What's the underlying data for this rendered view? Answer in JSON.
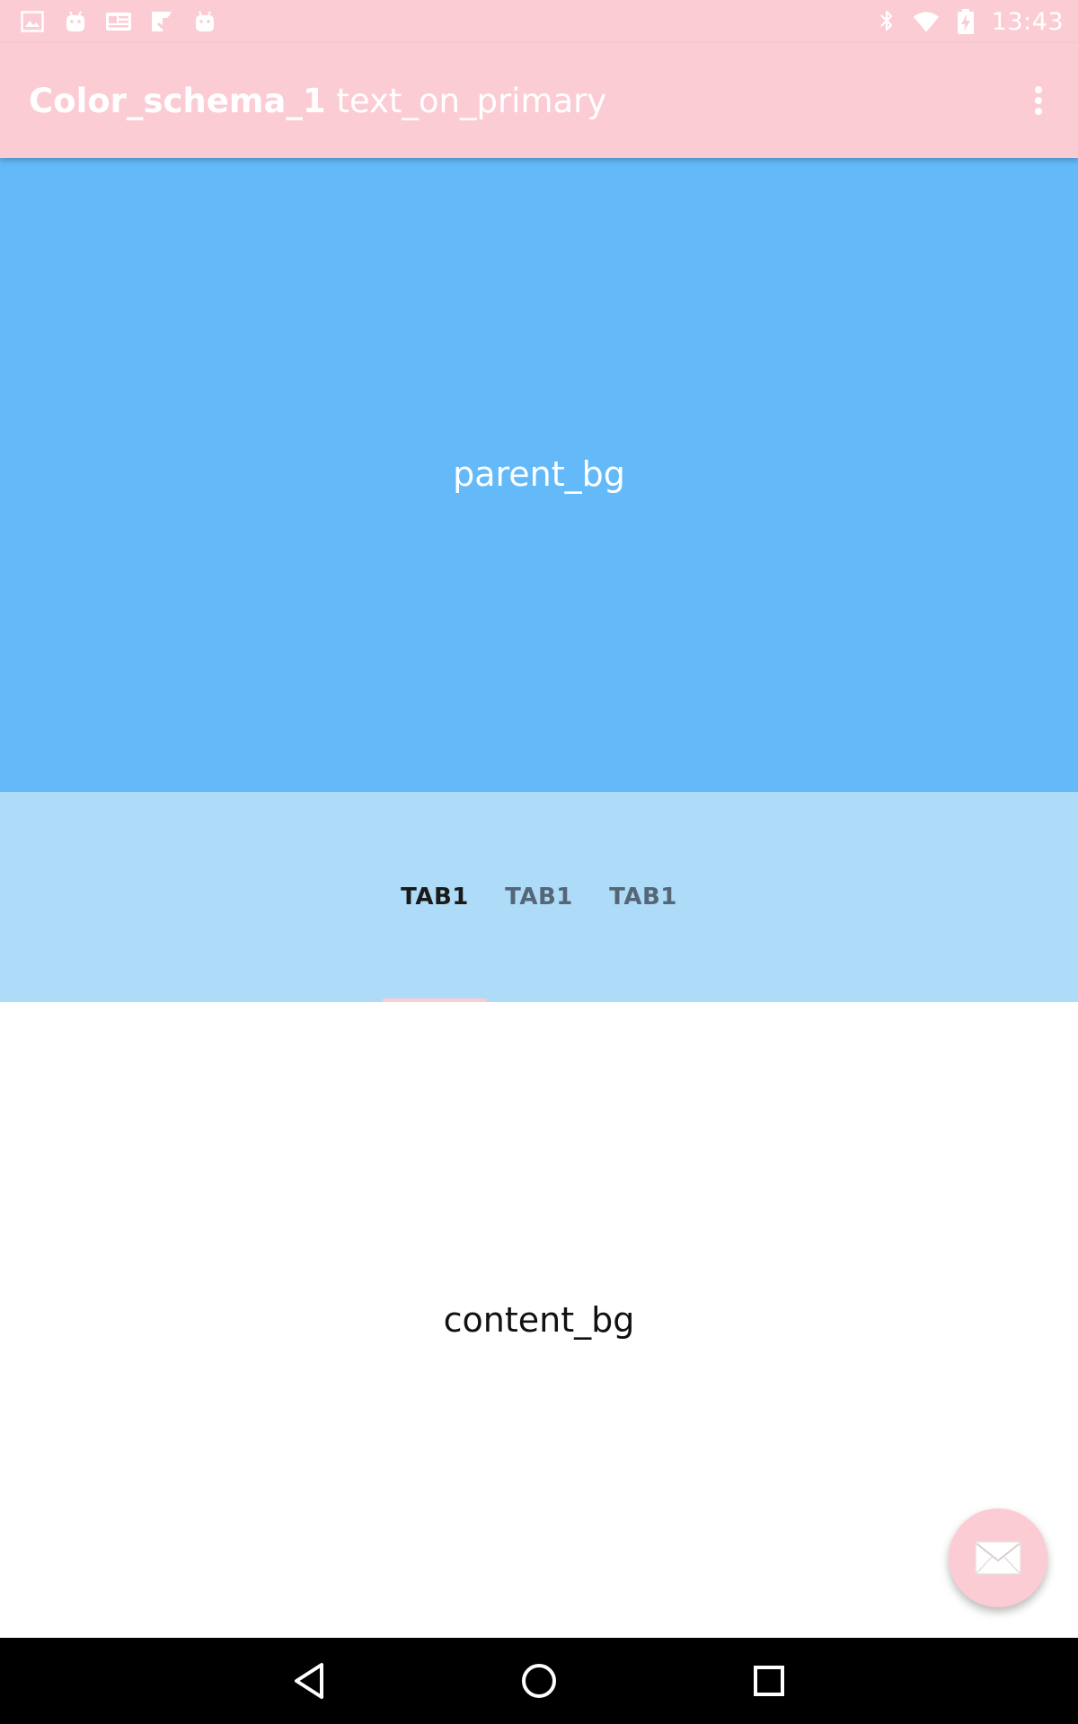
{
  "status_bar": {
    "time": "13:43",
    "left_icons": [
      "image-icon",
      "android-icon",
      "news-icon",
      "play-store-icon",
      "android-icon"
    ],
    "right_icons": [
      "bluetooth-icon",
      "wifi-icon",
      "battery-charging-icon"
    ]
  },
  "app_bar": {
    "title": "Color_schema_1",
    "subtitle": "text_on_primary",
    "menu_icon": "more-vertical-icon"
  },
  "parent_area": {
    "label": "parent_bg"
  },
  "tabs": [
    {
      "label": "TAB1",
      "selected": true
    },
    {
      "label": "TAB1",
      "selected": false
    },
    {
      "label": "TAB1",
      "selected": false
    }
  ],
  "content_area": {
    "label": "content_bg"
  },
  "fab": {
    "icon": "email-icon"
  },
  "nav_bar": {
    "icons": [
      "back-icon",
      "home-icon",
      "recents-icon"
    ]
  },
  "colors": {
    "primary": "#fcccd4",
    "parent_bg": "#64baf8",
    "tab_bar_bg": "#aedbf8",
    "content_bg": "#ffffff",
    "text_on_primary": "#ffffff",
    "tab_indicator": "#fcccd4"
  }
}
